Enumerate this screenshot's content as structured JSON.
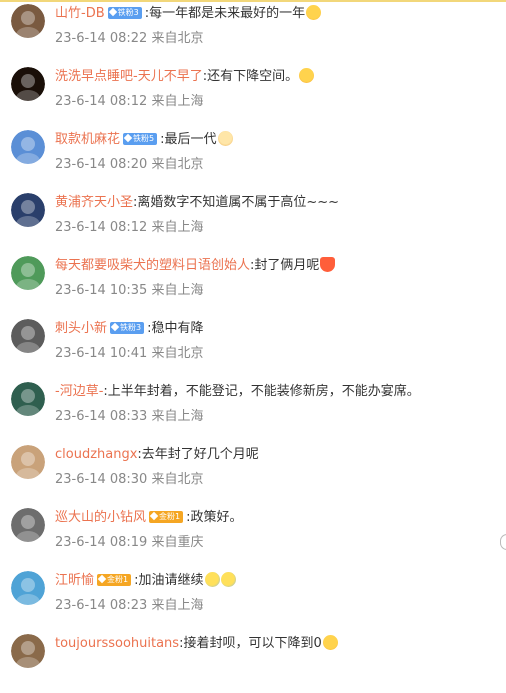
{
  "comments": [
    {
      "user": "山竹-DB",
      "badge": {
        "text": "铁粉3",
        "color": "blue"
      },
      "text": ":每一年都是未来最好的一年",
      "emoji": "smile",
      "time": "23-6-14 08:22",
      "location": "来自北京",
      "avatar_color": "#7a5a40"
    },
    {
      "user": "洗洗早点睡吧-天儿不早了",
      "badge": null,
      "text": ":还有下降空间。",
      "emoji": "kiss",
      "time": "23-6-14 08:12",
      "location": "来自上海",
      "avatar_color": "#1a0f08"
    },
    {
      "user": "取款机麻花",
      "badge": {
        "text": "铁粉5",
        "color": "blue"
      },
      "text": ":最后一代",
      "emoji": "cat",
      "time": "23-6-14 08:20",
      "location": "来自北京",
      "avatar_color": "#5b8fd6"
    },
    {
      "user": "黄浦齐天小圣",
      "badge": null,
      "text": ":离婚数字不知道属不属于高位~~~",
      "emoji": null,
      "time": "23-6-14 08:12",
      "location": "来自上海",
      "avatar_color": "#2a3f6b"
    },
    {
      "user": "每天都要吸柴犬的塑料日语创始人",
      "badge": null,
      "text": ":封了俩月呢",
      "emoji": "crown",
      "time": "23-6-14 10:35",
      "location": "来自上海",
      "avatar_color": "#4f9a5a"
    },
    {
      "user": "刺头小新",
      "badge": {
        "text": "铁粉3",
        "color": "blue"
      },
      "text": ":稳中有降",
      "emoji": null,
      "time": "23-6-14 10:41",
      "location": "来自北京",
      "avatar_color": "#5c5c5c"
    },
    {
      "user": "-河边草-",
      "badge": null,
      "text": ":上半年封着，不能登记，不能装修新房，不能办宴席。",
      "emoji": null,
      "time": "23-6-14 08:33",
      "location": "来自上海",
      "avatar_color": "#2f5f4f"
    },
    {
      "user": "cloudzhangx",
      "badge": null,
      "text": ":去年封了好几个月呢",
      "emoji": null,
      "time": "23-6-14 08:30",
      "location": "来自北京",
      "avatar_color": "#c9a27a"
    },
    {
      "user": "巡大山的小钻风",
      "badge": {
        "text": "金粉1",
        "color": "gold"
      },
      "text": ":政策好。",
      "emoji": null,
      "time": "23-6-14 08:19",
      "location": "来自重庆",
      "avatar_color": "#6d6d6d"
    },
    {
      "user": "江昕愉",
      "badge": {
        "text": "金粉1",
        "color": "gold"
      },
      "text": ":加油请继续",
      "emoji": "sweat2",
      "time": "23-6-14 08:23",
      "location": "来自上海",
      "avatar_color": "#4fa3d6"
    },
    {
      "user": "toujourssoohuitans",
      "badge": null,
      "text": ":接着封呗，可以下降到0",
      "emoji": "smile",
      "time": "",
      "location": "",
      "avatar_color": "#8a6a4a"
    }
  ],
  "icons": {
    "scroll_handle": "scroll-handle-icon"
  }
}
